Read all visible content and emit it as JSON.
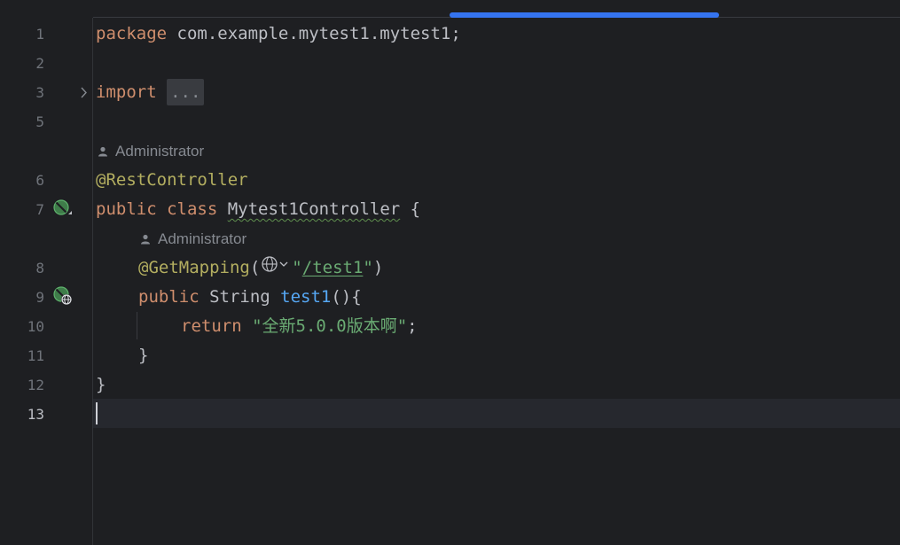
{
  "editor": {
    "line_numbers": [
      "1",
      "2",
      "3",
      "5",
      "6",
      "7",
      "8",
      "9",
      "10",
      "11",
      "12",
      "13"
    ],
    "current_line": "13",
    "code": {
      "l1_kw": "package",
      "l1_rest": " com.example.mytest1.mytest1;",
      "l3_kw": "import",
      "l3_fold": "...",
      "l6_ann": "@RestController",
      "l7_kw": "public class",
      "l7_class": "Mytest1Controller",
      "l7_rest": " {",
      "l8_ann": "@GetMapping",
      "l8_open": "(",
      "l8_q1": "\"",
      "l8_url": "/test1",
      "l8_q2": "\"",
      "l8_close": ")",
      "l9_kw": "public",
      "l9_type": " String ",
      "l9_fn": "test1",
      "l9_rest": "(){",
      "l10_kw": "return",
      "l10_str": "\"全新5.0.0版本啊\"",
      "l10_end": ";",
      "l11": "}",
      "l12": "}"
    },
    "inlay_hints": {
      "class_author": "Administrator",
      "method_author": "Administrator"
    },
    "icons": {
      "fold": "chevron-right-icon",
      "bean": "spring-bean-icon",
      "endpoint": "spring-endpoint-globe-icon",
      "author": "person-icon",
      "url_globe": "globe-icon"
    },
    "colors": {
      "background": "#1e1f22",
      "keyword": "#cf8e6d",
      "annotation": "#b3ae60",
      "string": "#6aab73",
      "function": "#56a8f5",
      "text": "#bcbec4",
      "accent": "#3574f0"
    }
  }
}
